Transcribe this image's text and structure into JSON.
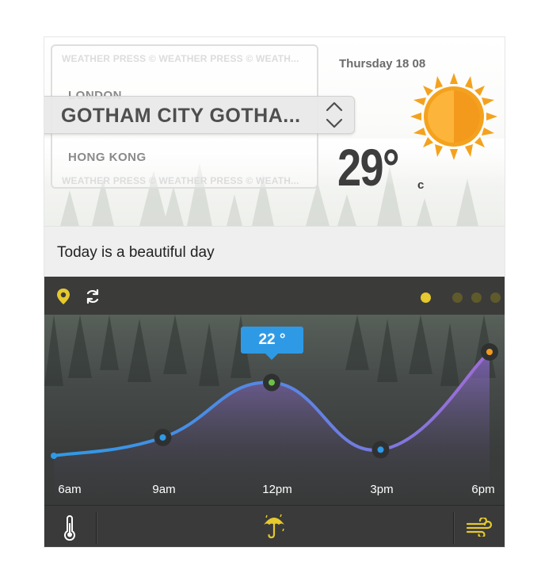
{
  "watermark": {
    "top": "WEATHER PRESS © WEATHER PRESS © WEATH...",
    "bottom": "WEATHER PRESS © WEATHER PRESS © WEATH..."
  },
  "cities": {
    "previous": "LONDON",
    "current": "GOTHAM CITY GOTHA...",
    "next": "HONG KONG"
  },
  "weather": {
    "date": "Thursday 18 08",
    "temperature": "29°",
    "unit": "c",
    "condition_icon": "sun-icon",
    "message": "Today is a beautiful day"
  },
  "toolbar": {
    "icons": [
      "location-pin-icon",
      "refresh-icon"
    ],
    "page_dots": 4,
    "active_dot": 0
  },
  "chart_data": {
    "type": "line",
    "x": [
      "6am",
      "9am",
      "12pm",
      "3pm",
      "6pm"
    ],
    "tooltip_label": "22 °",
    "highlighted_index": 2,
    "values": [
      10,
      13,
      22,
      11,
      27
    ],
    "colors": {
      "line_start": "#2e9ae6",
      "line_end": "#a16bd6",
      "point_default": "#2e9ae6",
      "point_highlight": "#6cc04a",
      "point_last": "#f39a1d",
      "tooltip": "#2e9ae6"
    }
  },
  "bottom_bar": {
    "icons": [
      "thermometer-icon",
      "umbrella-icon",
      "wind-icon"
    ],
    "accent": "#e5c92d"
  }
}
